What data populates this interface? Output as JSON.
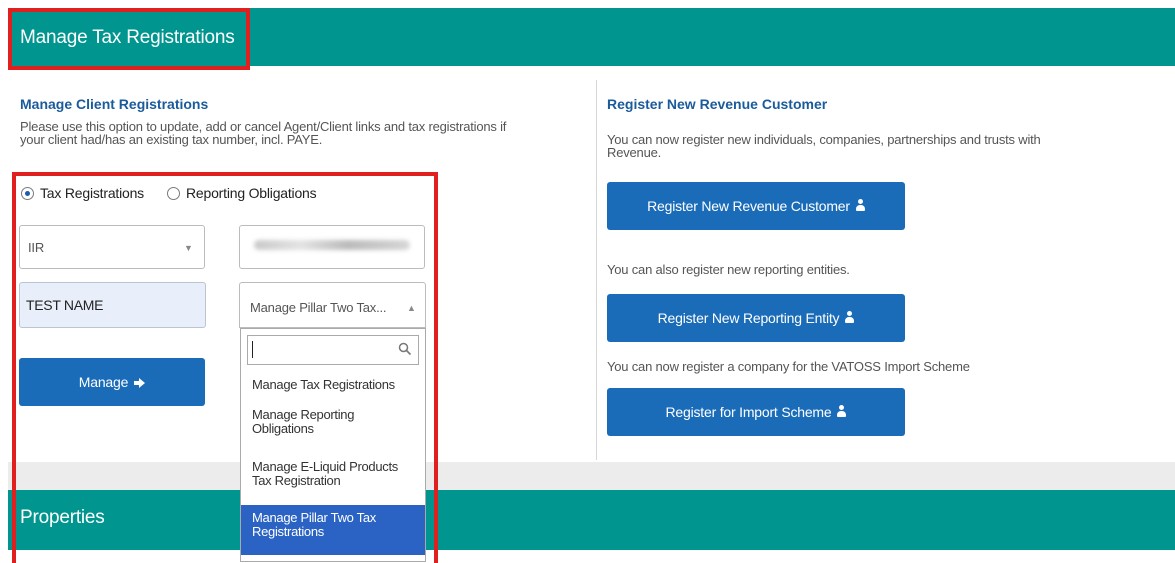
{
  "header": {
    "title": "Manage Tax Registrations"
  },
  "left": {
    "heading": "Manage Client Registrations",
    "description_lines": [
      "Please use this option to update, add or cancel Agent/Client links and tax registrations if",
      "your client had/has an existing tax number, incl. PAYE."
    ],
    "radios": [
      {
        "label": "Tax Registrations",
        "checked": true
      },
      {
        "label": "Reporting Obligations",
        "checked": false
      }
    ],
    "tax_type_select": {
      "value": "IIR"
    },
    "name_field": {
      "value": "TEST NAME"
    },
    "action_select": {
      "value": "Manage Pillar Two Tax...",
      "search_value": "",
      "options": [
        {
          "lines": [
            "Manage Tax Registrations"
          ],
          "selected": false
        },
        {
          "lines": [
            "Manage Reporting",
            "Obligations"
          ],
          "selected": false
        },
        {
          "lines": [
            "Manage E-Liquid Products",
            "Tax Registration"
          ],
          "selected": false
        },
        {
          "lines": [
            "Manage Pillar Two Tax",
            "Registrations"
          ],
          "selected": true
        }
      ]
    },
    "manage_button": {
      "label": "Manage"
    }
  },
  "right": {
    "heading": "Register New Revenue Customer",
    "description_lines": [
      "You can now register new individuals, companies, partnerships and trusts with",
      "Revenue."
    ],
    "register_customer_button": {
      "label": "Register New Revenue Customer"
    },
    "entities_text": "You can also register new reporting entities.",
    "register_entity_button": {
      "label": "Register New Reporting Entity"
    },
    "vatoss_text": "You can now register a company for the VATOSS Import Scheme",
    "import_scheme_button": {
      "label": "Register for Import Scheme"
    }
  },
  "properties": {
    "title": "Properties"
  },
  "icons": {
    "select_caret": "caret-down-icon",
    "dropdown_caret": "caret-up-icon",
    "search": "magnifier-icon",
    "manage_arrow": "arrow-right-icon",
    "register_person": "person-icon"
  },
  "colors": {
    "header_teal": "#00968f",
    "annotation_red": "#e0201f",
    "button_blue": "#1a6cb8",
    "heading_blue": "#1a5b9b",
    "selected_option": "#2b63c4",
    "input_highlight": "#e8effb"
  }
}
